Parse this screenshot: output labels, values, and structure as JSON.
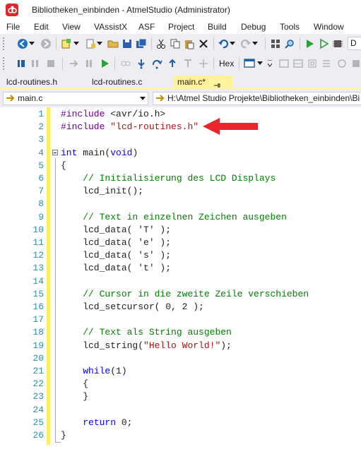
{
  "window": {
    "title": "Bibliotheken_einbinden - AtmelStudio (Administrator)"
  },
  "menu": [
    "File",
    "Edit",
    "View",
    "VAssistX",
    "ASF",
    "Project",
    "Build",
    "Debug",
    "Tools",
    "Window"
  ],
  "toolbar": {
    "hex_label": "Hex",
    "cut_off_label": "D"
  },
  "tabs": [
    {
      "label": "lcd-routines.h",
      "active": false
    },
    {
      "label": "lcd-routines.c",
      "active": false
    },
    {
      "label": "main.c*",
      "active": true
    }
  ],
  "navbar": {
    "file_combo": "main.c",
    "path_combo": "H:\\Atmel Studio Projekte\\Bibliotheken_einbinden\\Bi"
  },
  "editor": {
    "lines": [
      {
        "n": "1",
        "text": "#include <avr/io.h>"
      },
      {
        "n": "2",
        "text": "#include \"lcd-routines.h\""
      },
      {
        "n": "3",
        "text": ""
      },
      {
        "n": "4",
        "text": "int main(void)"
      },
      {
        "n": "5",
        "text": "{"
      },
      {
        "n": "6",
        "text": "    // Initialisierung des LCD Displays"
      },
      {
        "n": "7",
        "text": "    lcd_init();"
      },
      {
        "n": "8",
        "text": ""
      },
      {
        "n": "9",
        "text": "    // Text in einzelnen Zeichen ausgeben"
      },
      {
        "n": "10",
        "text": "    lcd_data( 'T' );"
      },
      {
        "n": "11",
        "text": "    lcd_data( 'e' );"
      },
      {
        "n": "12",
        "text": "    lcd_data( 's' );"
      },
      {
        "n": "13",
        "text": "    lcd_data( 't' );"
      },
      {
        "n": "14",
        "text": ""
      },
      {
        "n": "15",
        "text": "    // Cursor in die zweite Zeile verschieben"
      },
      {
        "n": "16",
        "text": "    lcd_setcursor( 0, 2 );"
      },
      {
        "n": "17",
        "text": ""
      },
      {
        "n": "18",
        "text": "    // Text als String ausgeben"
      },
      {
        "n": "19",
        "text": "    lcd_string(\"Hello World!\");"
      },
      {
        "n": "20",
        "text": ""
      },
      {
        "n": "21",
        "text": "    while(1)"
      },
      {
        "n": "22",
        "text": "    {"
      },
      {
        "n": "23",
        "text": "    }"
      },
      {
        "n": "24",
        "text": ""
      },
      {
        "n": "25",
        "text": "    return 0;"
      },
      {
        "n": "26",
        "text": "}"
      }
    ]
  },
  "colors": {
    "accent_tab": "#fff29d",
    "change_bar": "#ffee62",
    "line_number": "#2b91af",
    "keyword": "#0000ff",
    "preprocessor": "#6f008a",
    "comment": "#008000",
    "string": "#a31515",
    "annotation_arrow": "#e8262b"
  }
}
